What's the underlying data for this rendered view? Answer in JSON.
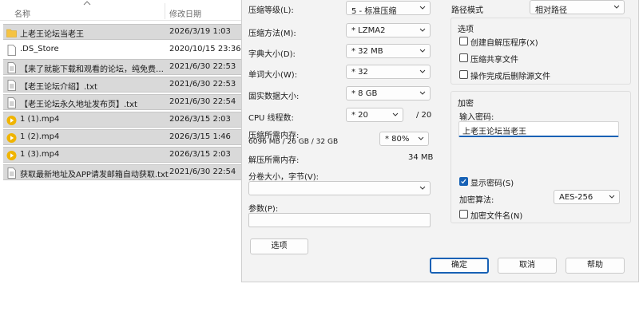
{
  "explorer": {
    "col_name": "名称",
    "col_date": "修改日期",
    "files": [
      {
        "name": "上老王论坛当老王",
        "date": "2026/3/19 1:03",
        "icon": "folder-icon",
        "selected": true
      },
      {
        "name": ".DS_Store",
        "date": "2020/10/15 23:36",
        "icon": "file-icon",
        "selected": false
      },
      {
        "name": "【来了就能下载和观看的论坛，纯免费！...",
        "date": "2021/6/30 22:53",
        "icon": "text-file-icon",
        "selected": true
      },
      {
        "name": "【老王论坛介绍】.txt",
        "date": "2021/6/30 22:53",
        "icon": "text-file-icon",
        "selected": true
      },
      {
        "name": "【老王论坛永久地址发布页】.txt",
        "date": "2021/6/30 22:54",
        "icon": "text-file-icon",
        "selected": true
      },
      {
        "name": "1 (1).mp4",
        "date": "2026/3/15 2:03",
        "icon": "video-file-icon",
        "selected": true
      },
      {
        "name": "1 (2).mp4",
        "date": "2026/3/15 1:46",
        "icon": "video-file-icon",
        "selected": true
      },
      {
        "name": "1 (3).mp4",
        "date": "2026/3/15 2:03",
        "icon": "video-file-icon",
        "selected": true
      },
      {
        "name": "获取最新地址及APP请发邮箱自动获取.txt",
        "date": "2021/6/30 22:54",
        "icon": "text-file-icon",
        "selected": true
      }
    ]
  },
  "dialog": {
    "compression_level": {
      "label": "压缩等级(L):",
      "value": "5 - 标准压缩"
    },
    "compression_method": {
      "label": "压缩方法(M):",
      "value": "* LZMA2"
    },
    "dictionary_size": {
      "label": "字典大小(D):",
      "value": "* 32 MB"
    },
    "word_size": {
      "label": "单词大小(W):",
      "value": "* 32"
    },
    "solid_block": {
      "label": "固实数据大小:",
      "value": "* 8 GB"
    },
    "cpu_threads": {
      "label": "CPU 线程数:",
      "value": "* 20",
      "max": "/ 20"
    },
    "memory_compress": {
      "label": "压缩所需内存:",
      "detail": "6096 MB / 26 GB / 32 GB",
      "value": "* 80%"
    },
    "memory_decompress": {
      "label": "解压所需内存:",
      "value": "34 MB"
    },
    "split_volume": {
      "label": "分卷大小，字节(V):",
      "value": ""
    },
    "parameters": {
      "label": "参数(P):",
      "value": ""
    },
    "options_button": "选项",
    "path_mode": {
      "label": "路径模式",
      "value": "相对路径"
    },
    "options_group": {
      "title": "选项",
      "create_sfx": "创建自解压程序(X)",
      "compress_shared": "压缩共享文件",
      "delete_after": "操作完成后删除源文件"
    },
    "encryption": {
      "title": "加密",
      "password_label": "输入密码:",
      "password_value": "上老王论坛当老王",
      "show_password": "显示密码(S)",
      "show_password_checked": true,
      "method_label": "加密算法:",
      "method_value": "AES-256",
      "encrypt_names": "加密文件名(N)"
    },
    "buttons": {
      "ok": "确定",
      "cancel": "取消",
      "help": "帮助"
    }
  },
  "colors": {
    "accent": "#1761b5",
    "folder": "#f5c342",
    "video": "#f0b400",
    "dialog_bg": "#f3f3f3"
  }
}
